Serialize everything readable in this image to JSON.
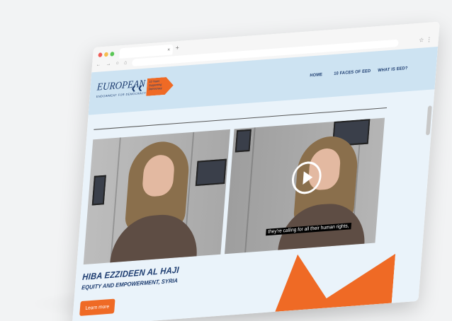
{
  "colors": {
    "brand_navy": "#1b3b6f",
    "accent_orange": "#ef6a25",
    "header_bg": "#cde3f2",
    "page_bg": "#eaf3fa"
  },
  "browser": {
    "new_tab_symbol": "+",
    "nav_symbols": "← → ○ ⌂",
    "bookmark_icon": "star-icon",
    "menu_symbol": "⋮",
    "tab_close_symbol": "×"
  },
  "header": {
    "logo_title": "EUROPEAN",
    "logo_subtitle": "ENDOWMENT FOR DEMOCRACY",
    "anniversary": "10 Years Supporting Democracy",
    "nav": [
      {
        "label": "HOME"
      },
      {
        "label": "10 FACES OF EED"
      },
      {
        "label": "WHAT IS EED?"
      }
    ]
  },
  "video": {
    "caption": "they're calling for all their human rights,",
    "play_icon": "play-icon"
  },
  "profile": {
    "name": "HIBA EZZIDEEN AL HAJI",
    "role": "EQUITY AND EMPOWERMENT, SYRIA",
    "cta": "Learn more"
  }
}
